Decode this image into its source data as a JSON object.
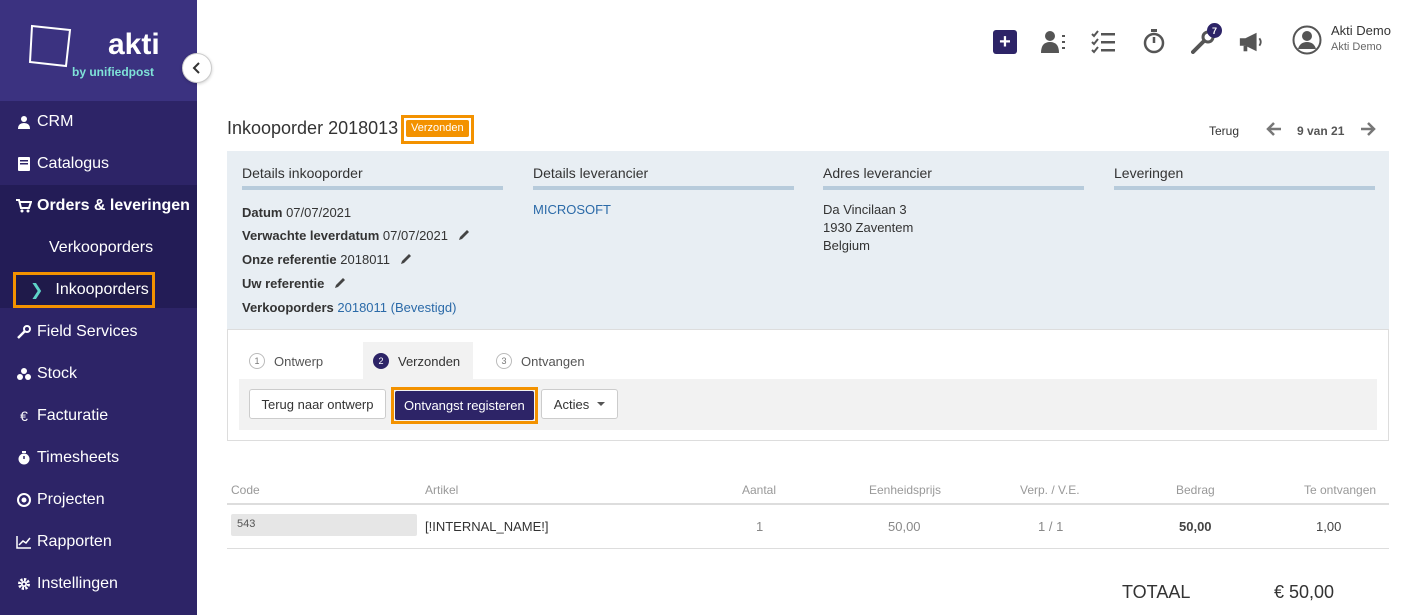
{
  "brand": {
    "name": "akti",
    "tagline": "by unifiedpost"
  },
  "sidebar": {
    "items": [
      {
        "label": "CRM",
        "icon": "user-icon"
      },
      {
        "label": "Catalogus",
        "icon": "book-icon"
      },
      {
        "label": "Orders & leveringen",
        "icon": "cart-icon"
      },
      {
        "label": "Field Services",
        "icon": "wrench-icon"
      },
      {
        "label": "Stock",
        "icon": "cubes-icon"
      },
      {
        "label": "Facturatie",
        "icon": "euro-icon"
      },
      {
        "label": "Timesheets",
        "icon": "stopwatch-icon"
      },
      {
        "label": "Projecten",
        "icon": "target-icon"
      },
      {
        "label": "Rapporten",
        "icon": "chart-icon"
      },
      {
        "label": "Instellingen",
        "icon": "gear-icon"
      }
    ],
    "sub_items": [
      {
        "label": "Verkooporders"
      },
      {
        "label": "Inkooporders"
      }
    ]
  },
  "topbar": {
    "badge_count": "7",
    "user_name": "Akti Demo",
    "user_company": "Akti Demo"
  },
  "header": {
    "title": "Inkooporder 2018013",
    "status": "Verzonden",
    "back_label": "Terug",
    "pager": "9 van 21"
  },
  "details": {
    "order": {
      "heading": "Details inkooporder",
      "datum_label": "Datum",
      "datum_value": "07/07/2021",
      "leverdatum_label": "Verwachte leverdatum",
      "leverdatum_value": "07/07/2021",
      "onze_ref_label": "Onze referentie",
      "onze_ref_value": "2018011",
      "uw_ref_label": "Uw referentie",
      "verkooporders_label": "Verkooporders",
      "verkooporders_value": "2018011 (Bevestigd)"
    },
    "supplier": {
      "heading": "Details leverancier",
      "name": "MICROSOFT"
    },
    "address": {
      "heading": "Adres leverancier",
      "line1": "Da Vincilaan 3",
      "line2": "1930 Zaventem",
      "line3": "Belgium"
    },
    "deliveries": {
      "heading": "Leveringen"
    }
  },
  "steps": [
    {
      "num": "1",
      "label": "Ontwerp"
    },
    {
      "num": "2",
      "label": "Verzonden"
    },
    {
      "num": "3",
      "label": "Ontvangen"
    }
  ],
  "actions": {
    "back_to_draft": "Terug naar ontwerp",
    "register_receipt": "Ontvangst registeren",
    "actions": "Acties"
  },
  "table": {
    "headers": [
      "Code",
      "Artikel",
      "Aantal",
      "Eenheidsprijs",
      "Verp. / V.E.",
      "Bedrag",
      "Te ontvangen"
    ],
    "rows": [
      {
        "code": "543",
        "artikel": "[!INTERNAL_NAME!]",
        "aantal": "1",
        "prijs": "50,00",
        "verp": "1 / 1",
        "bedrag": "50,00",
        "te_ontvangen": "1,00"
      }
    ],
    "total_label": "TOTAAL",
    "total_value": "€ 50,00"
  }
}
